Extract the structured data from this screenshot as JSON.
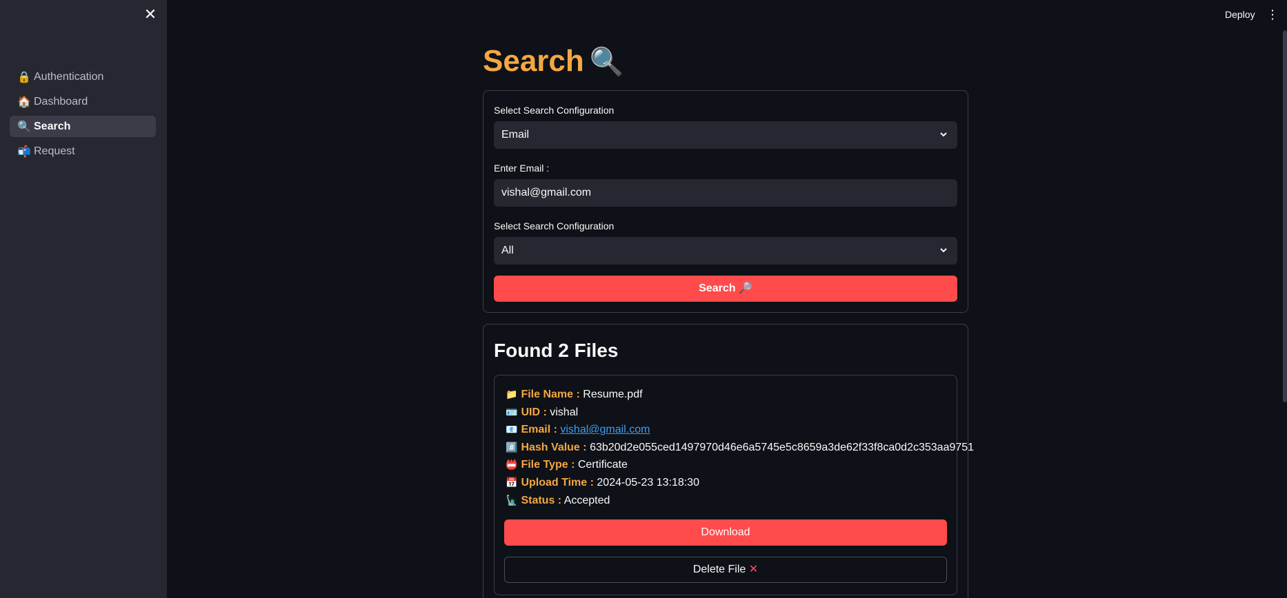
{
  "sidebar": {
    "close_glyph": "✕",
    "items": [
      {
        "icon": "🔒",
        "label": "Authentication",
        "active": false
      },
      {
        "icon": "🏠",
        "label": "Dashboard",
        "active": false
      },
      {
        "icon": "🔍",
        "label": "Search",
        "active": true
      },
      {
        "icon": "📬",
        "label": "Request",
        "active": false
      }
    ]
  },
  "header": {
    "deploy_label": "Deploy",
    "menu_glyph": "⋮"
  },
  "main": {
    "title": "Search",
    "title_icon": "🔍",
    "config": {
      "label_1": "Select Search Configuration",
      "select_1_value": "Email",
      "email_label": "Enter Email :",
      "email_value": "vishal@gmail.com",
      "label_2": "Select Search Configuration",
      "select_2_value": "All",
      "search_button": "Search 🔎"
    },
    "results": {
      "title": "Found 2 Files",
      "file": {
        "name_key": "File Name :",
        "name_val": "Resume.pdf",
        "uid_key": "UID :",
        "uid_val": "vishal",
        "email_key": "Email :",
        "email_val": "vishal@gmail.com",
        "hash_key": "Hash Value :",
        "hash_val": "63b20d2e055ced1497970d46e6a5745e5c8659a3de62f33f8ca0d2c353aa9751",
        "type_key": "File Type :",
        "type_val": "Certificate",
        "upload_key": "Upload Time :",
        "upload_val": "2024-05-23 13:18:30",
        "status_key": "Status :",
        "status_val": "Accepted",
        "download_label": "Download",
        "delete_label": "Delete File",
        "delete_glyph": "✕"
      }
    }
  },
  "colors": {
    "accent": "#ff4b4b",
    "title": "#f5a742",
    "link": "#3d9df3",
    "background": "#0e1117",
    "sidebar": "#262730"
  },
  "icons": {
    "file": "folder-icon",
    "uid": "id-card-icon",
    "email": "envelope-icon",
    "hash": "hash-icon",
    "type": "certificate-icon",
    "upload": "calendar-icon",
    "status": "statue-icon"
  }
}
